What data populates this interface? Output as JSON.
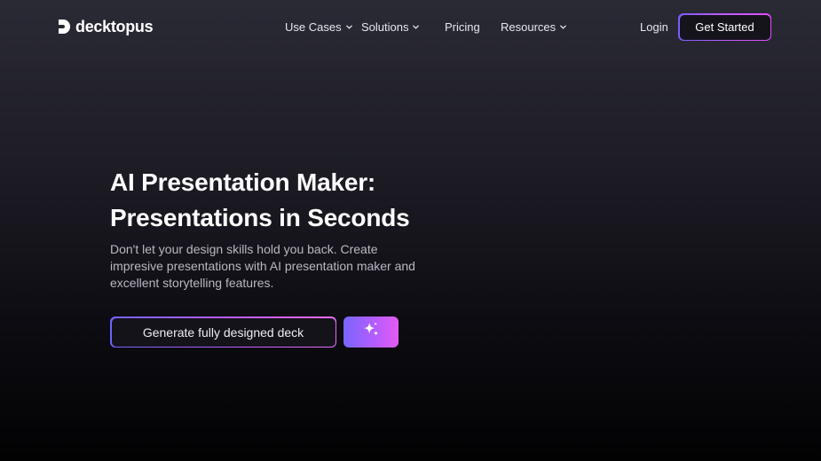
{
  "brand": {
    "name": "decktopus"
  },
  "nav": {
    "items": [
      {
        "label": "Use Cases",
        "has_dropdown": true
      },
      {
        "label": "Solutions",
        "has_dropdown": true
      },
      {
        "label": "Pricing",
        "has_dropdown": false
      },
      {
        "label": "Resources",
        "has_dropdown": true
      }
    ],
    "login_label": "Login",
    "cta_label": "Get Started"
  },
  "hero": {
    "title_line1": "AI Presentation Maker:",
    "title_line2": "Presentations in Seconds",
    "subtitle": "Don't let your design skills hold you back. Create impresive presentations with AI presentation maker and excellent storytelling features.",
    "primary_button": "Generate fully designed deck",
    "magic_button_icon": "sparkles-icon"
  },
  "colors": {
    "accent_start": "#7a5cff",
    "accent_mid": "#b95cff",
    "accent_end": "#e24cff",
    "background_top": "#2a2a35",
    "background_bottom": "#020203"
  }
}
